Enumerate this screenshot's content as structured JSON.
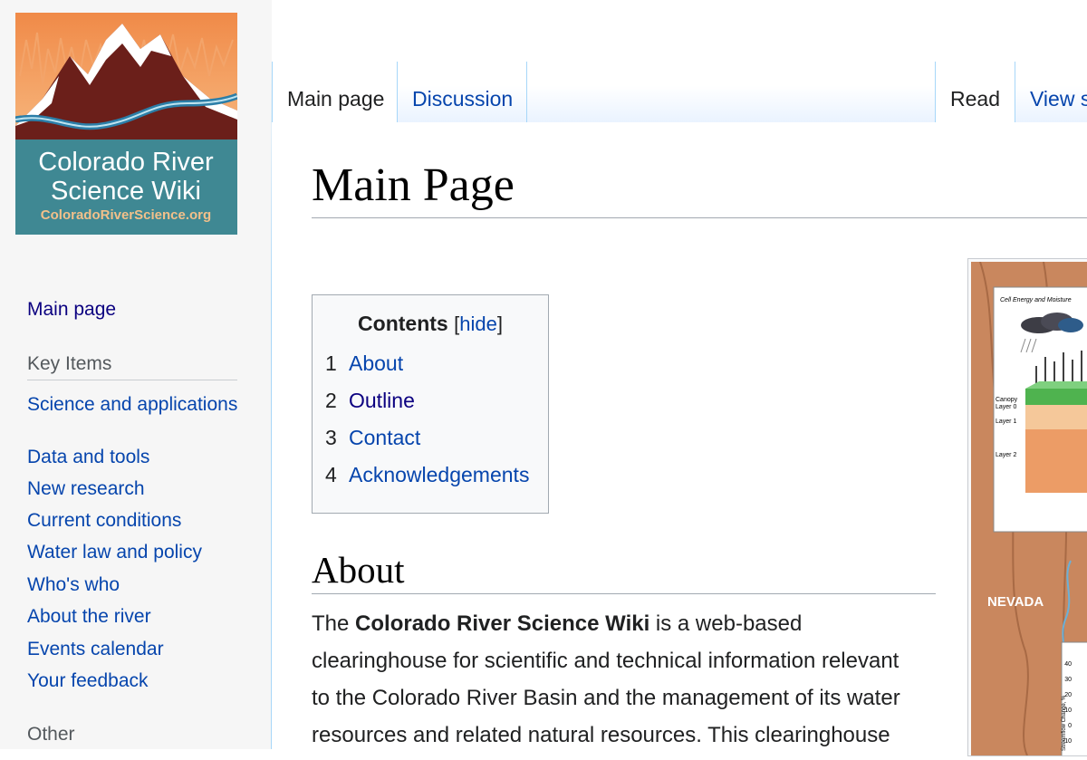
{
  "logo": {
    "line1": "Colorado River",
    "line2": "Science Wiki",
    "url": "ColoradoRiverScience.org"
  },
  "sidebar": {
    "main_page": "Main page",
    "key_items_heading": "Key Items",
    "key_items": [
      "Science and applications",
      "Data and tools",
      "New research",
      "Current conditions",
      "Water law and policy",
      "Who's who",
      "About the river",
      "Events calendar",
      "Your feedback"
    ],
    "other_heading": "Other"
  },
  "tabs": {
    "main_page": "Main page",
    "discussion": "Discussion",
    "read": "Read",
    "view_source": "View s"
  },
  "page": {
    "title": "Main Page"
  },
  "toc": {
    "title": "Contents",
    "toggle": "hide",
    "items": [
      {
        "num": "1",
        "text": "About"
      },
      {
        "num": "2",
        "text": "Outline"
      },
      {
        "num": "3",
        "text": "Contact"
      },
      {
        "num": "4",
        "text": "Acknowledgements"
      }
    ]
  },
  "about": {
    "heading": "About",
    "text_before": "The ",
    "text_bold": "Colorado River Science Wiki",
    "text_line1_after": " is a web-based",
    "line2": "clearinghouse for scientific and technical information relevant",
    "line3": "to the Colorado River Basin and the management of its water",
    "line4": "resources and related natural resources. This clearinghouse"
  },
  "figure": {
    "panel_title": "Cell Energy and Moisture",
    "labels": {
      "canopy": "Canopy",
      "layer0": "Layer 0",
      "layer1": "Layer 1",
      "layer2": "Layer 2",
      "state": "NEVADA",
      "y_axis": "Streamflow Change, %",
      "ticks": [
        "40",
        "30",
        "20",
        "10",
        "0",
        "-10"
      ]
    }
  }
}
